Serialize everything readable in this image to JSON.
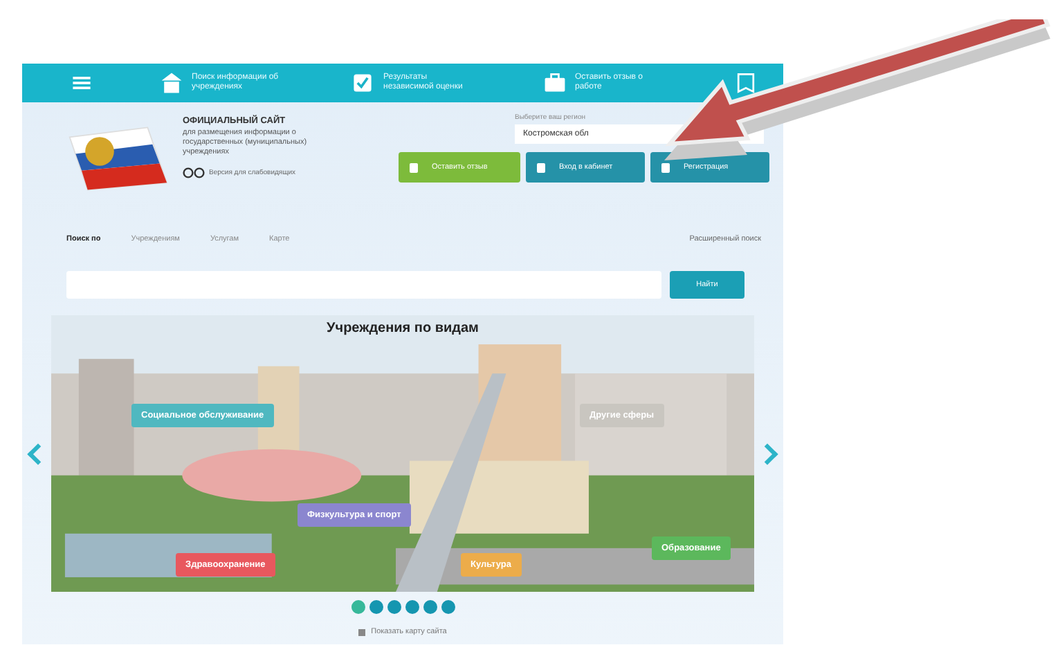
{
  "nav": [
    {
      "kind": "menu"
    },
    {
      "kind": "building",
      "label": "Поиск информации об учреждениях"
    },
    {
      "kind": "check",
      "label": "Результаты независимой оценки"
    },
    {
      "kind": "case",
      "label": "Оставить отзыв о работе"
    },
    {
      "kind": "book"
    }
  ],
  "header": {
    "title": "ОФИЦИАЛЬНЫЙ САЙТ",
    "subtitle": "для размещения информации о государственных (муниципальных) учреждениях",
    "accessibility": "Версия для слабовидящих",
    "region_label": "Выберите ваш регион",
    "region_value": "Костромская обл"
  },
  "actions": [
    {
      "kind": "feedback",
      "label": "Оставить отзыв"
    },
    {
      "kind": "login",
      "label": "Вход в кабинет"
    },
    {
      "kind": "user",
      "label": "Регистрация"
    }
  ],
  "search_tabs": [
    {
      "label": "Поиск по",
      "selected": true
    },
    {
      "label": "Учреждениям",
      "selected": false
    },
    {
      "label": "Услугам",
      "selected": false
    },
    {
      "label": "Карте",
      "selected": false
    }
  ],
  "advanced_link": "Расширенный поиск",
  "search_button": "Найти",
  "carousel": {
    "title": "Учреждения по видам",
    "categories": [
      {
        "label": "Социальное обслуживание",
        "color": "#4fb8c0"
      },
      {
        "label": "Другие сферы",
        "color": "#c9c6c0"
      },
      {
        "label": "Физкультура и спорт",
        "color": "#8b86cf"
      },
      {
        "label": "Здравоохранение",
        "color": "#e8585e"
      },
      {
        "label": "Культура",
        "color": "#ecac4a"
      },
      {
        "label": "Образование",
        "color": "#5cb85c"
      }
    ],
    "dots": [
      {
        "selected": true
      },
      {
        "selected": false
      },
      {
        "selected": false
      },
      {
        "selected": false
      },
      {
        "selected": false
      },
      {
        "selected": false
      }
    ]
  },
  "sitemap_link": "Показать карту сайта"
}
